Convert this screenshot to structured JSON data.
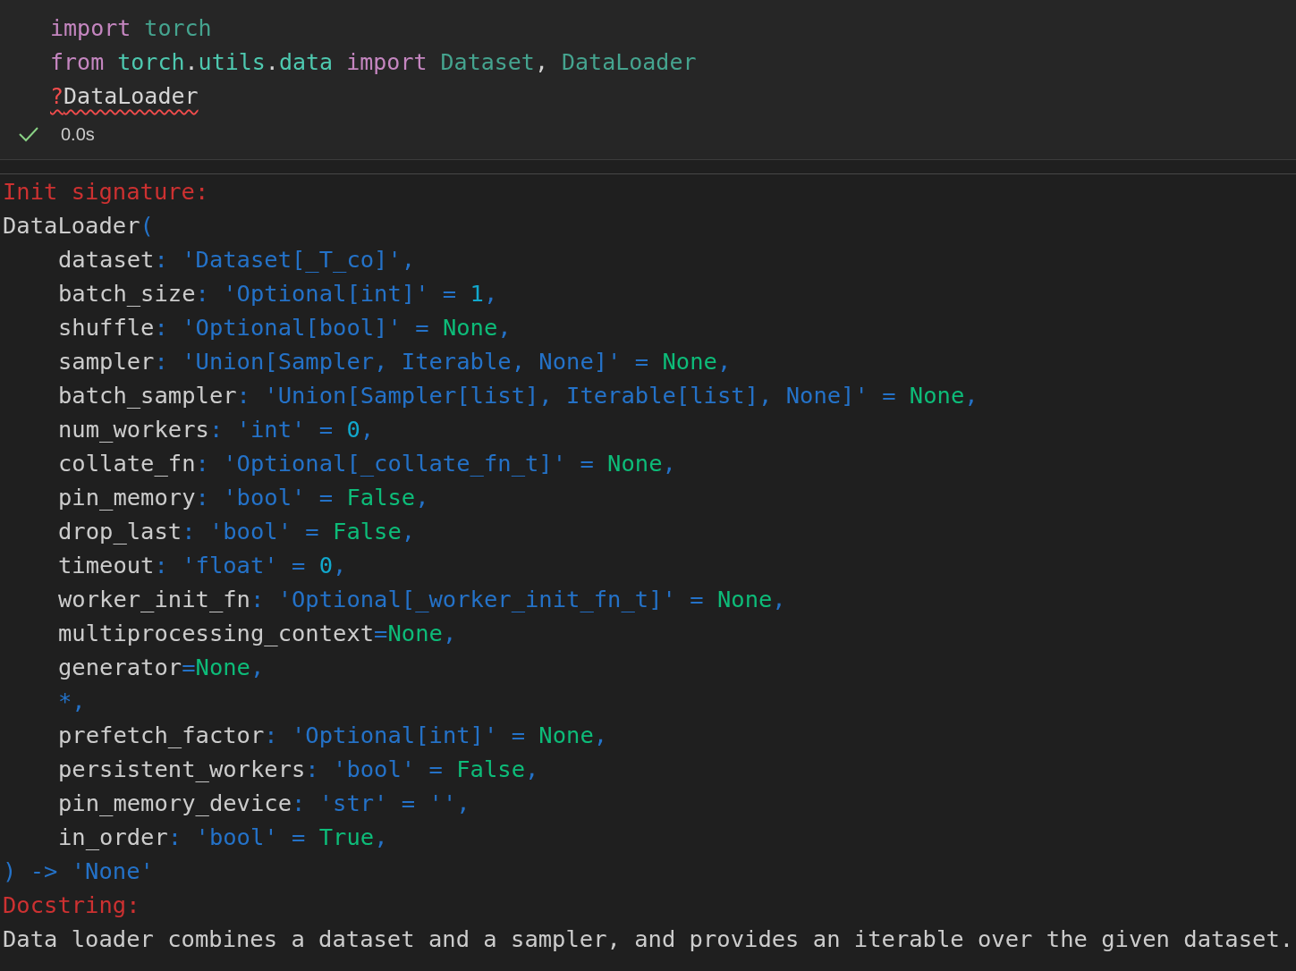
{
  "cell": {
    "code_lines": [
      {
        "squiggle": false,
        "tokens": [
          {
            "text": "import ",
            "kind": "kw"
          },
          {
            "text": "torch",
            "kind": "cls"
          }
        ]
      },
      {
        "squiggle": false,
        "tokens": [
          {
            "text": "from ",
            "kind": "kw"
          },
          {
            "text": "torch",
            "kind": "ns"
          },
          {
            "text": ".",
            "kind": "plain"
          },
          {
            "text": "utils",
            "kind": "ns"
          },
          {
            "text": ".",
            "kind": "plain"
          },
          {
            "text": "data ",
            "kind": "ns"
          },
          {
            "text": "import ",
            "kind": "kw"
          },
          {
            "text": "Dataset",
            "kind": "cls"
          },
          {
            "text": ", ",
            "kind": "plain"
          },
          {
            "text": "DataLoader",
            "kind": "cls"
          }
        ]
      },
      {
        "squiggle": true,
        "tokens": [
          {
            "text": "?",
            "kind": "err"
          },
          {
            "text": "DataLoader",
            "kind": "plain"
          }
        ]
      }
    ],
    "status": {
      "succeeded": true,
      "duration": "0.0s"
    }
  },
  "output": {
    "lines": [
      {
        "indent": false,
        "tokens": [
          {
            "text": "Init signature:",
            "kind": "hdr"
          }
        ]
      },
      {
        "indent": false,
        "tokens": [
          {
            "text": "DataLoader",
            "kind": "plain"
          },
          {
            "text": "(",
            "kind": "str"
          }
        ]
      },
      {
        "indent": true,
        "tokens": [
          {
            "text": "dataset",
            "kind": "plain"
          },
          {
            "text": ": 'Dataset[_T_co]',",
            "kind": "str"
          }
        ]
      },
      {
        "indent": true,
        "tokens": [
          {
            "text": "batch_size",
            "kind": "plain"
          },
          {
            "text": ": 'Optional[int]' = ",
            "kind": "str"
          },
          {
            "text": "1",
            "kind": "num"
          },
          {
            "text": ",",
            "kind": "str"
          }
        ]
      },
      {
        "indent": true,
        "tokens": [
          {
            "text": "shuffle",
            "kind": "plain"
          },
          {
            "text": ": 'Optional[bool]' = ",
            "kind": "str"
          },
          {
            "text": "None",
            "kind": "const"
          },
          {
            "text": ",",
            "kind": "str"
          }
        ]
      },
      {
        "indent": true,
        "tokens": [
          {
            "text": "sampler",
            "kind": "plain"
          },
          {
            "text": ": 'Union[Sampler, Iterable, None]' = ",
            "kind": "str"
          },
          {
            "text": "None",
            "kind": "const"
          },
          {
            "text": ",",
            "kind": "str"
          }
        ]
      },
      {
        "indent": true,
        "tokens": [
          {
            "text": "batch_sampler",
            "kind": "plain"
          },
          {
            "text": ": 'Union[Sampler[list], Iterable[list], None]' = ",
            "kind": "str"
          },
          {
            "text": "None",
            "kind": "const"
          },
          {
            "text": ",",
            "kind": "str"
          }
        ]
      },
      {
        "indent": true,
        "tokens": [
          {
            "text": "num_workers",
            "kind": "plain"
          },
          {
            "text": ": 'int' = ",
            "kind": "str"
          },
          {
            "text": "0",
            "kind": "num"
          },
          {
            "text": ",",
            "kind": "str"
          }
        ]
      },
      {
        "indent": true,
        "tokens": [
          {
            "text": "collate_fn",
            "kind": "plain"
          },
          {
            "text": ": 'Optional[_collate_fn_t]' = ",
            "kind": "str"
          },
          {
            "text": "None",
            "kind": "const"
          },
          {
            "text": ",",
            "kind": "str"
          }
        ]
      },
      {
        "indent": true,
        "tokens": [
          {
            "text": "pin_memory",
            "kind": "plain"
          },
          {
            "text": ": 'bool' = ",
            "kind": "str"
          },
          {
            "text": "False",
            "kind": "const"
          },
          {
            "text": ",",
            "kind": "str"
          }
        ]
      },
      {
        "indent": true,
        "tokens": [
          {
            "text": "drop_last",
            "kind": "plain"
          },
          {
            "text": ": 'bool' = ",
            "kind": "str"
          },
          {
            "text": "False",
            "kind": "const"
          },
          {
            "text": ",",
            "kind": "str"
          }
        ]
      },
      {
        "indent": true,
        "tokens": [
          {
            "text": "timeout",
            "kind": "plain"
          },
          {
            "text": ": 'float' = ",
            "kind": "str"
          },
          {
            "text": "0",
            "kind": "num"
          },
          {
            "text": ",",
            "kind": "str"
          }
        ]
      },
      {
        "indent": true,
        "tokens": [
          {
            "text": "worker_init_fn",
            "kind": "plain"
          },
          {
            "text": ": 'Optional[_worker_init_fn_t]' = ",
            "kind": "str"
          },
          {
            "text": "None",
            "kind": "const"
          },
          {
            "text": ",",
            "kind": "str"
          }
        ]
      },
      {
        "indent": true,
        "tokens": [
          {
            "text": "multiprocessing_context",
            "kind": "plain"
          },
          {
            "text": "=",
            "kind": "str"
          },
          {
            "text": "None",
            "kind": "const"
          },
          {
            "text": ",",
            "kind": "str"
          }
        ]
      },
      {
        "indent": true,
        "tokens": [
          {
            "text": "generator",
            "kind": "plain"
          },
          {
            "text": "=",
            "kind": "str"
          },
          {
            "text": "None",
            "kind": "const"
          },
          {
            "text": ",",
            "kind": "str"
          }
        ]
      },
      {
        "indent": true,
        "tokens": [
          {
            "text": "*,",
            "kind": "str"
          }
        ]
      },
      {
        "indent": true,
        "tokens": [
          {
            "text": "prefetch_factor",
            "kind": "plain"
          },
          {
            "text": ": 'Optional[int]' = ",
            "kind": "str"
          },
          {
            "text": "None",
            "kind": "const"
          },
          {
            "text": ",",
            "kind": "str"
          }
        ]
      },
      {
        "indent": true,
        "tokens": [
          {
            "text": "persistent_workers",
            "kind": "plain"
          },
          {
            "text": ": 'bool' = ",
            "kind": "str"
          },
          {
            "text": "False",
            "kind": "const"
          },
          {
            "text": ",",
            "kind": "str"
          }
        ]
      },
      {
        "indent": true,
        "tokens": [
          {
            "text": "pin_memory_device",
            "kind": "plain"
          },
          {
            "text": ": 'str' = '',",
            "kind": "str"
          }
        ]
      },
      {
        "indent": true,
        "tokens": [
          {
            "text": "in_order",
            "kind": "plain"
          },
          {
            "text": ": 'bool' = ",
            "kind": "str"
          },
          {
            "text": "True",
            "kind": "const"
          },
          {
            "text": ",",
            "kind": "str"
          }
        ]
      },
      {
        "indent": false,
        "tokens": [
          {
            "text": ") -> 'None'",
            "kind": "str"
          }
        ]
      },
      {
        "indent": false,
        "tokens": [
          {
            "text": "Docstring:",
            "kind": "hdr"
          }
        ]
      },
      {
        "indent": false,
        "tokens": [
          {
            "text": "Data loader combines a dataset and a sampler, and provides an iterable over the given dataset.",
            "kind": "plain"
          }
        ]
      }
    ]
  }
}
